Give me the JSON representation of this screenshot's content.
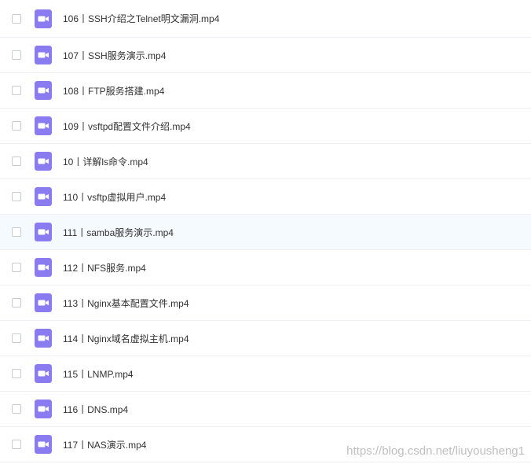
{
  "colors": {
    "icon_bg": "#8a7bf0",
    "icon_fg": "#ffffff",
    "row_border": "#eef0f3",
    "hover_bg": "#f5fafe",
    "text": "#333333"
  },
  "files": [
    {
      "name": "106丨SSH介绍之Telnet明文漏洞.mp4",
      "icon": "video-file-icon"
    },
    {
      "name": "107丨SSH服务演示.mp4",
      "icon": "video-file-icon"
    },
    {
      "name": "108丨FTP服务搭建.mp4",
      "icon": "video-file-icon"
    },
    {
      "name": "109丨vsftpd配置文件介绍.mp4",
      "icon": "video-file-icon"
    },
    {
      "name": "10丨详解ls命令.mp4",
      "icon": "video-file-icon"
    },
    {
      "name": "110丨vsftp虚拟用户.mp4",
      "icon": "video-file-icon"
    },
    {
      "name": "111丨samba服务演示.mp4",
      "icon": "video-file-icon",
      "hovered": true
    },
    {
      "name": "112丨NFS服务.mp4",
      "icon": "video-file-icon"
    },
    {
      "name": "113丨Nginx基本配置文件.mp4",
      "icon": "video-file-icon"
    },
    {
      "name": "114丨Nginx域名虚拟主机.mp4",
      "icon": "video-file-icon"
    },
    {
      "name": "115丨LNMP.mp4",
      "icon": "video-file-icon"
    },
    {
      "name": "116丨DNS.mp4",
      "icon": "video-file-icon"
    },
    {
      "name": "117丨NAS演示.mp4",
      "icon": "video-file-icon"
    }
  ],
  "watermark": "https://blog.csdn.net/liuyousheng1"
}
